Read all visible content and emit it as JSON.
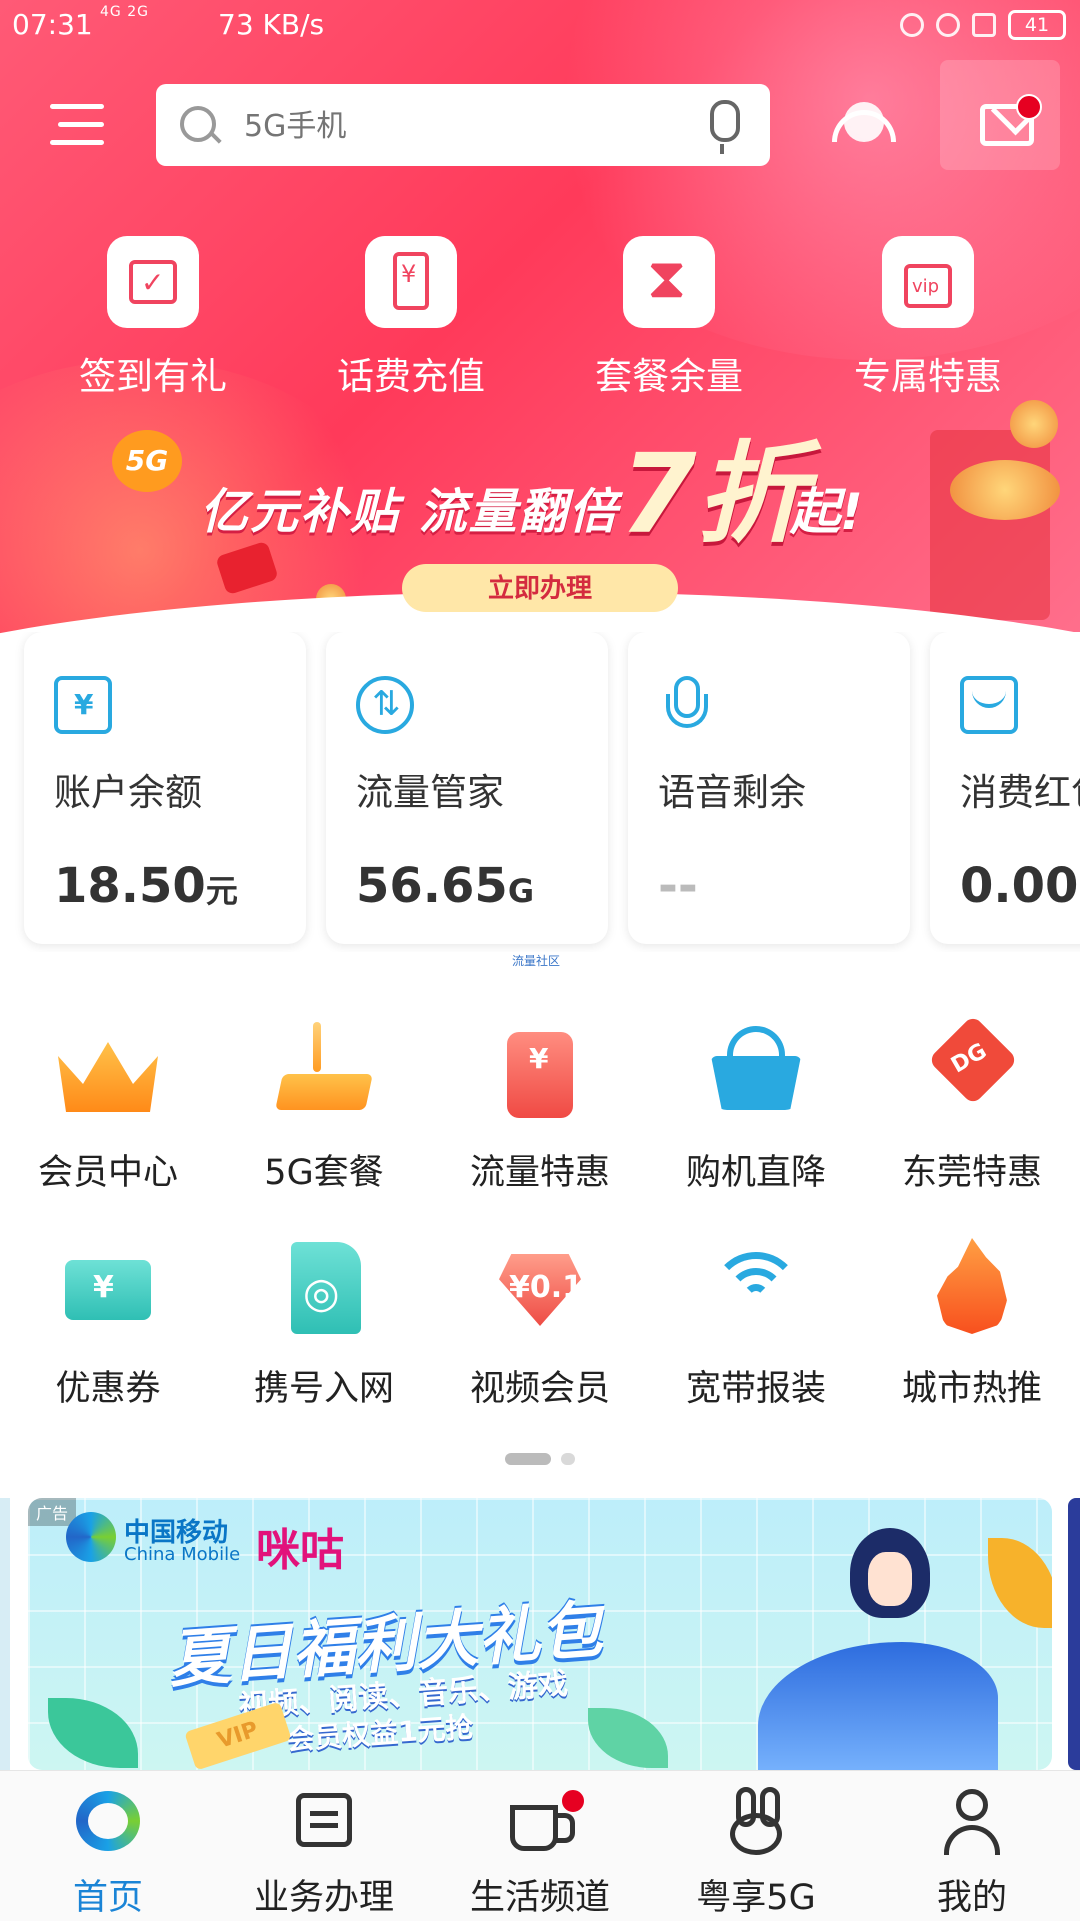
{
  "status_bar": {
    "time": "07:31",
    "network": "4G 2G",
    "speed": "73 KB/s",
    "battery": "41"
  },
  "header": {
    "search_placeholder": "5G手机"
  },
  "quick_actions": [
    {
      "label": "签到有礼",
      "icon": "calendar-check-icon"
    },
    {
      "label": "话费充值",
      "icon": "phone-yen-icon"
    },
    {
      "label": "套餐余量",
      "icon": "hourglass-icon"
    },
    {
      "label": "专属特惠",
      "icon": "vip-bag-icon"
    }
  ],
  "promo_banner": {
    "badge": "5G",
    "text_left": "亿元补贴 流量翻倍",
    "text_big": "7折",
    "text_tail": "起!",
    "button": "立即办理"
  },
  "account_cards": [
    {
      "title": "账户余额",
      "value": "18.50",
      "unit": "元",
      "icon": "wallet-yen-icon"
    },
    {
      "title": "流量管家",
      "value": "56.65",
      "unit": "G",
      "icon": "data-flow-icon"
    },
    {
      "title": "语音剩余",
      "value": "--",
      "unit": "",
      "icon": "microphone-icon"
    },
    {
      "title": "消费红包",
      "value": "0.00",
      "unit": "",
      "icon": "red-envelope-icon"
    }
  ],
  "cards_footer_label": "流量社区",
  "services_row1": [
    {
      "label": "会员中心",
      "icon": "crown-icon"
    },
    {
      "label": "5G套餐",
      "icon": "5g-phone-icon"
    },
    {
      "label": "流量特惠",
      "icon": "data-coupon-icon"
    },
    {
      "label": "购机直降",
      "icon": "shopping-basket-icon"
    },
    {
      "label": "东莞特惠",
      "icon": "dg-tag-icon"
    }
  ],
  "services_row2": [
    {
      "label": "优惠券",
      "icon": "coupon-ticket-icon"
    },
    {
      "label": "携号入网",
      "icon": "sim-card-icon"
    },
    {
      "label": "视频会员",
      "icon": "diamond-icon",
      "badge": "¥0.1"
    },
    {
      "label": "宽带报装",
      "icon": "wifi-icon"
    },
    {
      "label": "城市热推",
      "icon": "flame-icon"
    }
  ],
  "ad_banner": {
    "tag": "广告",
    "brand_cn": "中国移动",
    "brand_en": "China Mobile",
    "partner": "咪咕",
    "headline": "夏日福利大礼包",
    "sub1": "视频、阅读、音乐、游戏",
    "sub2": "会员权益1元抢",
    "vip": "VIP"
  },
  "tab_bar": [
    {
      "label": "首页",
      "icon": "china-mobile-logo-icon",
      "active": true
    },
    {
      "label": "业务办理",
      "icon": "business-icon",
      "active": false
    },
    {
      "label": "生活频道",
      "icon": "coffee-cup-icon",
      "active": false
    },
    {
      "label": "粤享5G",
      "icon": "rabbit-icon",
      "active": false
    },
    {
      "label": "我的",
      "icon": "person-icon",
      "active": false
    }
  ],
  "colors": {
    "hero_red": "#ff3a5a",
    "accent_blue": "#1a84d6",
    "icon_blue": "#29a9e0",
    "badge_red": "#e60021"
  }
}
